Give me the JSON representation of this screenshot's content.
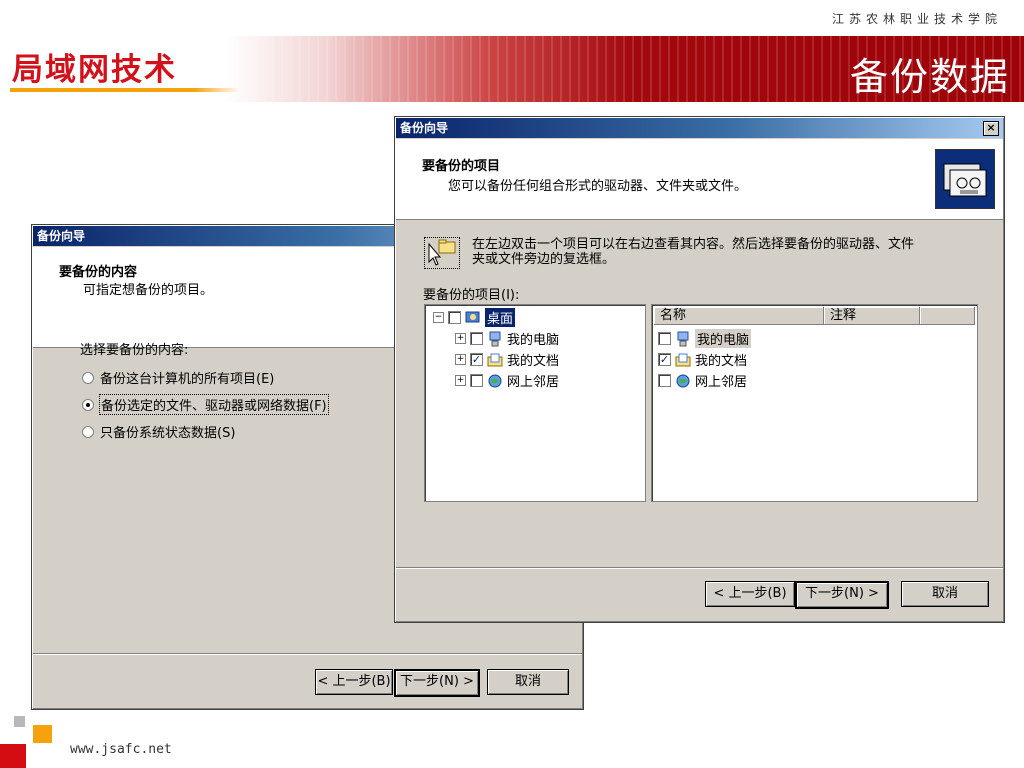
{
  "slide": {
    "school": "江苏农林职业技术学院",
    "logo": "局域网技术",
    "title": "备份数据",
    "footer_url": "www.jsafc.net"
  },
  "wizard_back": {
    "title": "备份向导",
    "header_title": "要备份的内容",
    "header_sub": "可指定想备份的项目。",
    "prompt": "选择要备份的内容:",
    "options": [
      {
        "label": "备份这台计算机的所有项目(E)",
        "selected": false
      },
      {
        "label": "备份选定的文件、驱动器或网络数据(F)",
        "selected": true
      },
      {
        "label": "只备份系统状态数据(S)",
        "selected": false
      }
    ],
    "back": "< 上一步(B)",
    "next": "下一步(N) >",
    "cancel": "取消"
  },
  "wizard_front": {
    "title": "备份向导",
    "close": "×",
    "header_title": "要备份的项目",
    "header_sub": "您可以备份任何组合形式的驱动器、文件夹或文件。",
    "hint_line1": "在左边双击一个项目可以在右边查看其内容。然后选择要备份的驱动器、文件",
    "hint_line2": "夹或文件旁边的复选框。",
    "items_label": "要备份的项目(I):",
    "tree": {
      "root": "桌面",
      "children": [
        {
          "label": "我的电脑",
          "checked": false,
          "icon": "computer-icon"
        },
        {
          "label": "我的文档",
          "checked": true,
          "icon": "documents-folder-icon"
        },
        {
          "label": "网上邻居",
          "checked": false,
          "icon": "network-icon"
        }
      ]
    },
    "list": {
      "columns": [
        "名称",
        "注释"
      ],
      "rows": [
        {
          "label": "我的电脑",
          "checked": false
        },
        {
          "label": "我的文档",
          "checked": true
        },
        {
          "label": "网上邻居",
          "checked": false
        }
      ]
    },
    "back": "< 上一步(B)",
    "next": "下一步(N) >",
    "cancel": "取消"
  },
  "colors": {
    "accent_red": "#a2080d",
    "accent_orange": "#f5a20c",
    "titlebar_blue": "#0a246a",
    "dialog_gray": "#d4d0c8"
  }
}
